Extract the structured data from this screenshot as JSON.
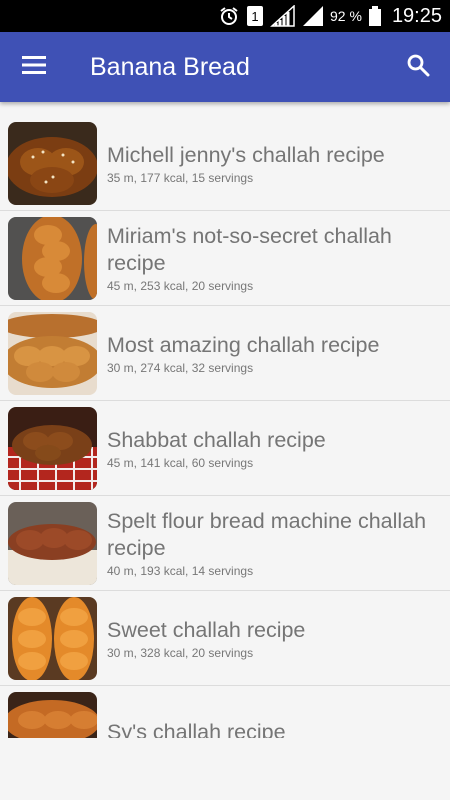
{
  "status_bar": {
    "sim_label": "1",
    "battery": "92 %",
    "time": "19:25",
    "icons": [
      "alarm-icon",
      "sim-icon",
      "signal-icon",
      "signal-icon",
      "battery-icon"
    ]
  },
  "app_bar": {
    "title": "Banana Bread",
    "color": "#3f51b5",
    "icons": [
      "menu-icon",
      "search-icon"
    ]
  },
  "recipes": [
    {
      "title": "Michell jenny's challah recipe",
      "meta": "35 m, 177 kcal, 15 servings"
    },
    {
      "title": "Miriam's not-so-secret challah recipe",
      "meta": "45 m, 253 kcal, 20 servings"
    },
    {
      "title": "Most amazing challah recipe",
      "meta": "30 m, 274 kcal, 32 servings"
    },
    {
      "title": "Shabbat challah recipe",
      "meta": "45 m, 141 kcal, 60 servings"
    },
    {
      "title": "Spelt flour bread machine challah recipe",
      "meta": "40 m, 193 kcal, 14 servings"
    },
    {
      "title": "Sweet challah recipe",
      "meta": "30 m, 328 kcal, 20 servings"
    },
    {
      "title": "Sy's challah recipe",
      "meta": ""
    }
  ]
}
